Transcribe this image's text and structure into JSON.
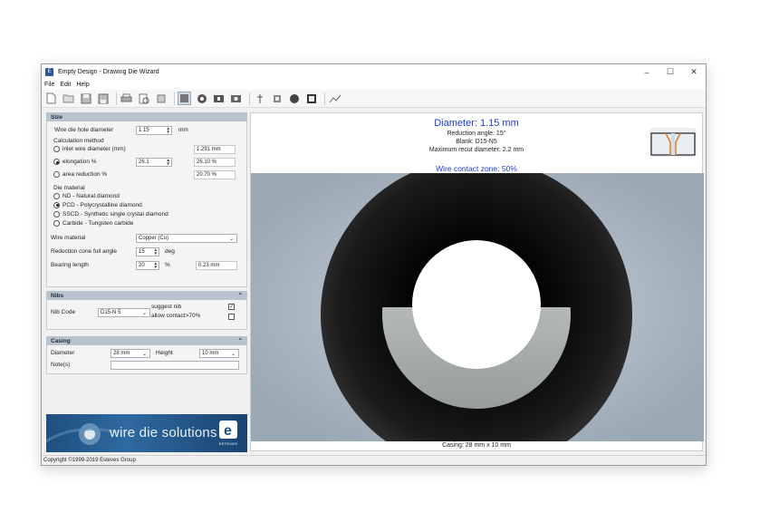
{
  "window": {
    "title": "Empty Design - Drawing Die Wizard",
    "minimize": "–",
    "maximize": "☐",
    "close": "✕"
  },
  "menu": [
    "File",
    "Edit",
    "Help"
  ],
  "size": {
    "header": "Size",
    "wire_die_hole_diameter_label": "Wire die hole diameter",
    "wire_die_hole_diameter_value": "1.15",
    "diameter_unit": "mm",
    "calc_method_label": "Calculation method",
    "inlet_label": "inlet wire diameter (mm)",
    "inlet_result": "1.291 mm",
    "elongation_label": "elongation %",
    "elongation_value": "26.1",
    "elongation_result": "26.10 %",
    "area_label": "area reduction %",
    "area_result": "20.70 %",
    "die_material_label": "Die material",
    "die_materials": [
      "ND - Natural diamond",
      "PCD - Polycrystalline diamond",
      "SSCD - Synthetic single crystal diamond",
      "Carbide - Tungsten carbide"
    ],
    "wire_material_label": "Wire material",
    "wire_material_value": "Copper (Cu)",
    "reduction_cone_label": "Reduction cone full angle",
    "reduction_cone_value": "15",
    "reduction_cone_unit": "deg",
    "bearing_label": "Bearing length",
    "bearing_value": "20",
    "bearing_unit": "%",
    "bearing_result": "0.23 mm"
  },
  "nibs": {
    "header": "Nibs",
    "nib_code_label": "Nib Code",
    "nib_code_value": "D15-N 5",
    "suggest_label": "suggest nib",
    "allow_label": "allow contact>70%"
  },
  "casing": {
    "header": "Casing",
    "diameter_label": "Diameter",
    "diameter_value": "28 mm",
    "height_label": "Height",
    "height_value": "10 mm",
    "notes_label": "Note(s)"
  },
  "banner": {
    "text": "wire die solutions",
    "brand": "ESTEVES"
  },
  "preview": {
    "title": "Diameter: 1.15 mm",
    "reduction_angle": "Reduction angle: 15°",
    "blank": "Blank: D15-N5",
    "max_recut": "Maximum recut diameter: 2.2 mm",
    "wire_contact": "Wire contact zone: 50%",
    "casing": "Casing: 28 mm x 10 mm"
  },
  "status": "Copyright ©1999-2019 Esteves Group",
  "colors": {
    "accent_blue": "#1c3ad6",
    "section_header": "#b9c3cf"
  }
}
